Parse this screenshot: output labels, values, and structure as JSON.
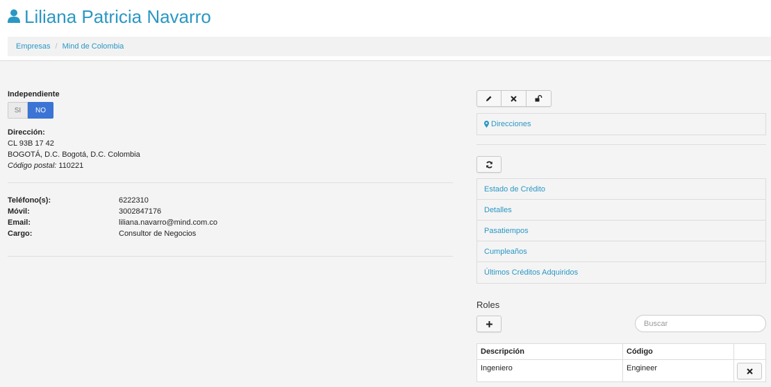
{
  "header": {
    "title": "Liliana Patricia Navarro",
    "breadcrumb": [
      "Empresas",
      "Mind de Colombia"
    ]
  },
  "contact": {
    "independiente_label": "Independiente",
    "toggle": {
      "off": "SI",
      "on": "NO",
      "selected": "NO"
    },
    "direccion_label": "Dirección:",
    "address_line1": "CL 93B 17 42",
    "address_line2": "BOGOTÁ, D.C. Bogotá, D.C. Colombia",
    "postal_label": "Código postal:",
    "postal_value": "110221",
    "fields": [
      {
        "label": "Teléfono(s):",
        "value": "6222310"
      },
      {
        "label": "Móvil:",
        "value": "3002847176"
      },
      {
        "label": "Email:",
        "value": "liliana.navarro@mind.com.co"
      },
      {
        "label": "Cargo:",
        "value": "Consultor de Negocios"
      }
    ]
  },
  "sidepanel": {
    "direcciones": "Direcciones",
    "menu": [
      "Estado de Crédito",
      "Detalles",
      "Pasatiempos",
      "Cumpleaños",
      "Últimos Créditos Adquiridos"
    ]
  },
  "roles": {
    "title": "Roles",
    "search_placeholder": "Buscar",
    "columns": [
      "Descripción",
      "Código",
      ""
    ],
    "rows": [
      {
        "descripcion": "Ingeniero",
        "codigo": "Engineer"
      }
    ]
  },
  "colors": {
    "link": "#2a97c4",
    "toggle_active": "#3b74d4"
  },
  "icons": [
    "user-icon",
    "pencil-icon",
    "times-icon",
    "unlock-icon",
    "map-marker-icon",
    "refresh-icon",
    "plus-icon",
    "times-icon"
  ]
}
